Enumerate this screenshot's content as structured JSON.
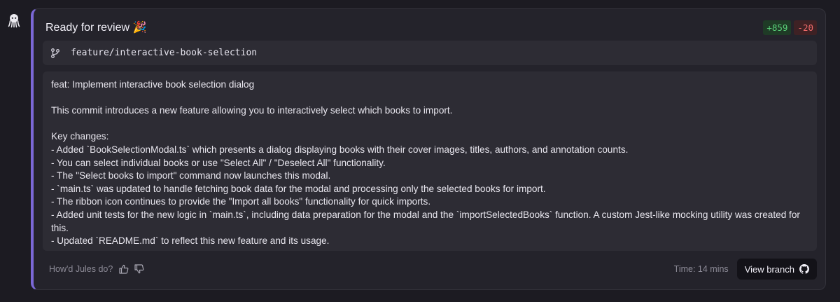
{
  "card": {
    "title": "Ready for review 🎉",
    "additions": "+859",
    "deletions": "-20",
    "branch": "feature/interactive-book-selection"
  },
  "message": {
    "lines": [
      "feat: Implement interactive book selection dialog",
      "",
      "This commit introduces a new feature allowing you to interactively select which books to import.",
      "",
      "Key changes:",
      "- Added `BookSelectionModal.ts` which presents a dialog displaying books with their cover images, titles, authors, and annotation counts.",
      "- You can select individual books or use \"Select All\" / \"Deselect All\" functionality.",
      "- The \"Select books to import\" command now launches this modal.",
      "- `main.ts` was updated to handle fetching book data for the modal and processing only the selected books for import.",
      "- The ribbon icon continues to provide the \"Import all books\" functionality for quick imports.",
      "- Added unit tests for the new logic in `main.ts`, including data preparation for the modal and the `importSelectedBooks` function. A custom Jest-like mocking utility was created for this.",
      "- Updated `README.md` to reflect this new feature and its usage."
    ]
  },
  "footer": {
    "feedback_label": "How'd Jules do?",
    "time": "Time: 14 mins",
    "view_branch_label": "View branch"
  },
  "colors": {
    "accent": "#7b68d6",
    "addition": "#5ad27a",
    "deletion": "#ef6a6a"
  },
  "icons": {
    "avatar": "jules-octopus-icon",
    "branch": "git-branch-icon",
    "thumbs_up": "thumbs-up-icon",
    "thumbs_down": "thumbs-down-icon",
    "github": "github-icon"
  }
}
